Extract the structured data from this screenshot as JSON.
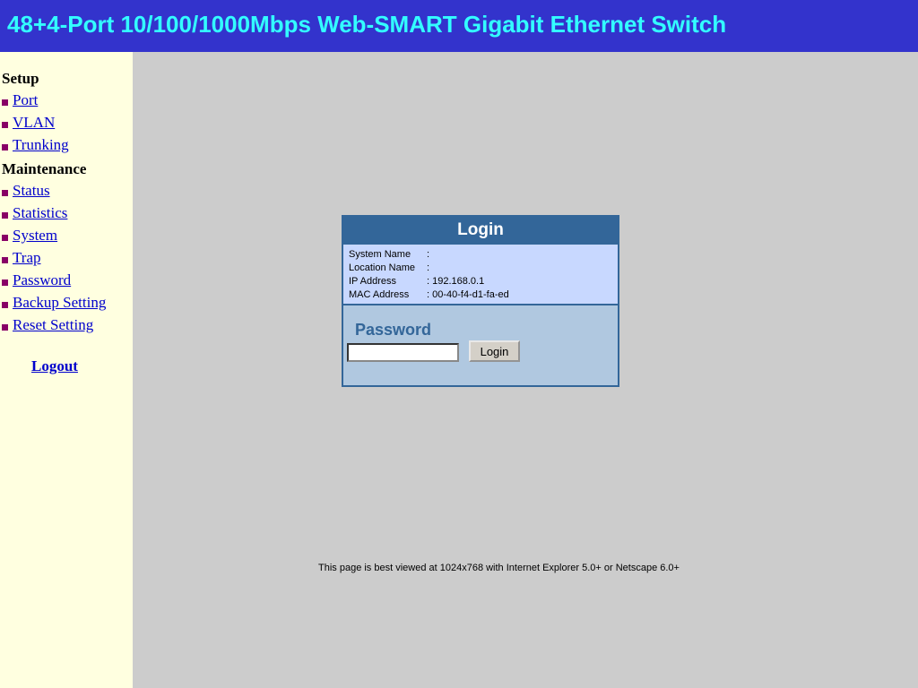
{
  "header": {
    "title": "48+4-Port 10/100/1000Mbps Web-SMART Gigabit Ethernet Switch"
  },
  "sidebar": {
    "setup_heading": "Setup",
    "setup_items": [
      {
        "label": "Port"
      },
      {
        "label": "VLAN"
      },
      {
        "label": "Trunking"
      }
    ],
    "maintenance_heading": "Maintenance",
    "maintenance_items": [
      {
        "label": "Status"
      },
      {
        "label": "Statistics"
      },
      {
        "label": "System"
      },
      {
        "label": "Trap"
      },
      {
        "label": "Password"
      },
      {
        "label": "Backup Setting"
      },
      {
        "label": "Reset Setting"
      }
    ],
    "logout_label": "Logout"
  },
  "login": {
    "title": "Login",
    "info": [
      {
        "label": "System Name",
        "value": ":"
      },
      {
        "label": "Location Name",
        "value": ":"
      },
      {
        "label": "IP Address",
        "value": ": 192.168.0.1"
      },
      {
        "label": "MAC Address",
        "value": ": 00-40-f4-d1-fa-ed"
      }
    ],
    "password_label": "Password",
    "password_value": "",
    "button_label": "Login"
  },
  "footer": {
    "note": "This page is best viewed at 1024x768 with Internet Explorer 5.0+ or Netscape 6.0+"
  },
  "colors": {
    "header_bg": "#3333cc",
    "header_text": "#33ffff",
    "sidebar_bg": "#ffffe0",
    "content_bg": "#cccccc",
    "login_accent": "#336699",
    "link": "#0000cc"
  }
}
